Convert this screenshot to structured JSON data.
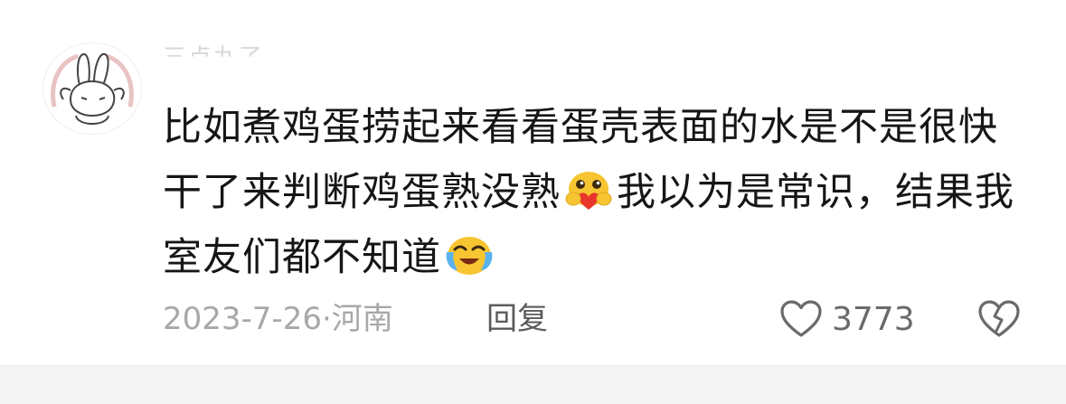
{
  "comment": {
    "username": "三点九了",
    "line_segments": [
      "比如煮鸡蛋捞起来看看蛋壳表面的水是不是很快干了来判断鸡蛋熟没熟",
      "我以为是常识，结果我室友们都不知道"
    ],
    "emojis": [
      "heart-hug-emoji-icon",
      "laughing-crying-emoji-icon"
    ],
    "date": "2023-7-26",
    "separator": "·",
    "location": "河南",
    "reply_label": "回复",
    "like_count": "3773"
  },
  "colors": {
    "text": "#161616",
    "meta": "#a8a8a8",
    "reply": "#5b5b5b",
    "icon": "#6a6a6a",
    "emoji_face": "#f7c531",
    "emoji_heart": "#e8352c",
    "tear": "#5ab3f0"
  }
}
